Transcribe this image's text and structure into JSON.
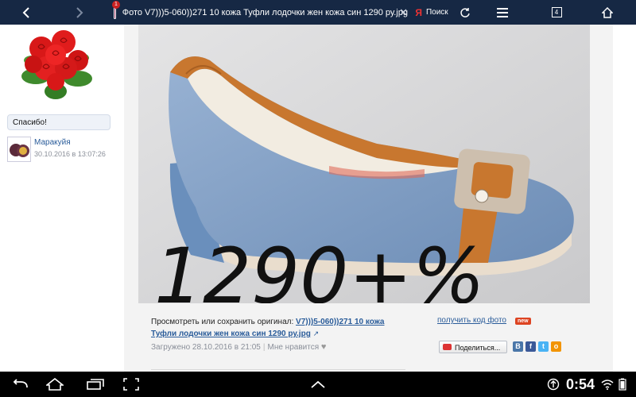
{
  "browser": {
    "tab_count": "1",
    "tab_title": "Фото V7)))5-060))271 10 кожа Туфли лодочки жен кожа син 1290 ру.jpg",
    "search_label": "Поиск",
    "search_logo": "Я",
    "tabs_count": "4",
    "icons": [
      "back-icon",
      "forward-icon",
      "close-icon",
      "refresh-icon",
      "menu-icon",
      "tabs-icon",
      "home-icon"
    ]
  },
  "sidebar": {
    "bubble_text": "Спасибо!",
    "user_name": "Маракуйя",
    "user_date": "30.10.2016 в 13:07:26"
  },
  "photo": {
    "handwritten_text": "1290+%"
  },
  "caption": {
    "prefix": "Просмотреть или сохранить оригинал: ",
    "link_text": "V7)))5-060))271 10 кожа Туфли лодочки жен кожа син 1290 ру.jpg",
    "ext_icon": "↗",
    "uploaded": "Загружено 28.10.2016 в 21:05",
    "separator": "|",
    "like_label": "Мне нравится",
    "heart": "♥",
    "get_code": "получить код фото",
    "new_badge": "new",
    "share_label": "Поделиться...",
    "social": [
      "В",
      "f",
      "t",
      "о"
    ]
  },
  "statusbar": {
    "clock": "0:54"
  },
  "colors": {
    "top_bar": "#162844",
    "link": "#2a5c9a",
    "shoe_blue": "#7e9bc0",
    "shoe_tan": "#c8772f"
  }
}
